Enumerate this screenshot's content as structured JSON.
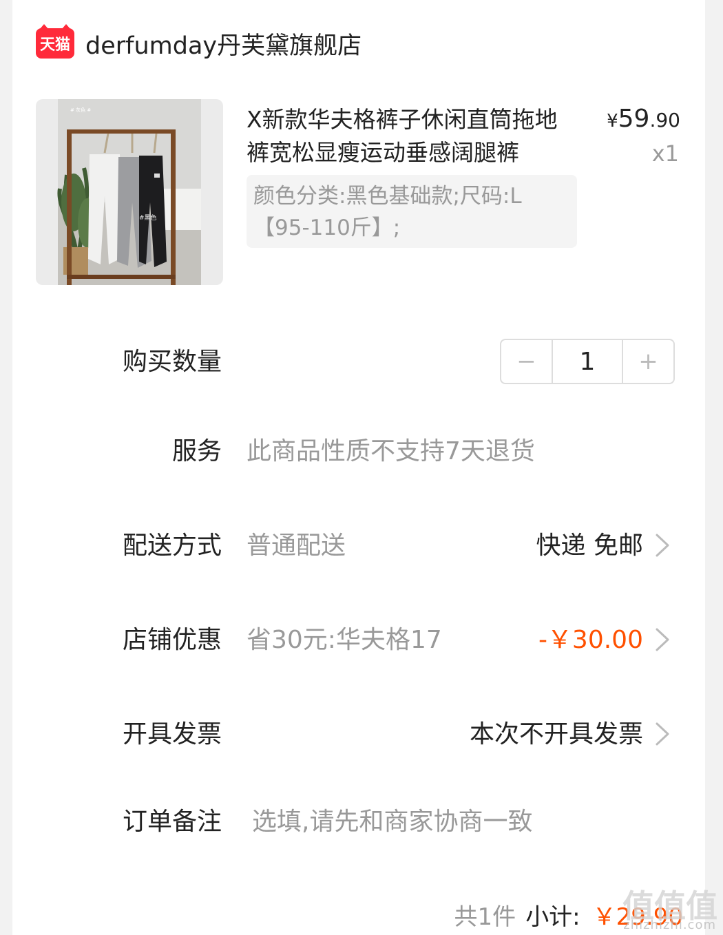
{
  "shop": {
    "platform_badge": "天猫",
    "name": "derfumday丹芙黛旗舰店"
  },
  "product": {
    "title": "X新款华夫格裤子休闲直筒拖地裤宽松显瘦运动垂感阔腿裤",
    "sku": "颜色分类:黑色基础款;尺码:L【95-110斤】;",
    "price_currency": "¥",
    "price_int": "59",
    "price_dec": ".90",
    "quantity_label": "x1",
    "image_text_1": "# 灰色 #",
    "image_text_2": "#黑色"
  },
  "quantity_row": {
    "label": "购买数量",
    "minus": "−",
    "value": "1",
    "plus": "+"
  },
  "service_row": {
    "label": "服务",
    "value": "此商品性质不支持7天退货"
  },
  "delivery_row": {
    "label": "配送方式",
    "value": "普通配送",
    "right": "快递 免邮"
  },
  "discount_row": {
    "label": "店铺优惠",
    "value": "省30元:华夫格17",
    "right": "-￥30.00"
  },
  "invoice_row": {
    "label": "开具发票",
    "right": "本次不开具发票"
  },
  "note_row": {
    "label": "订单备注",
    "placeholder": "选填,请先和商家协商一致"
  },
  "summary": {
    "count": "共1件",
    "subtotal_label": "小计:",
    "subtotal": "￥29.90"
  },
  "watermark": {
    "text": "值值值",
    "sub": "zhizhizhi.com"
  },
  "colors": {
    "accent": "#ff5000",
    "tmall_red": "#ff2a3a",
    "text": "#222222",
    "muted": "#999999"
  },
  "icons": {
    "shop": "tmall-icon",
    "row_arrow": "chevron-right-icon"
  }
}
